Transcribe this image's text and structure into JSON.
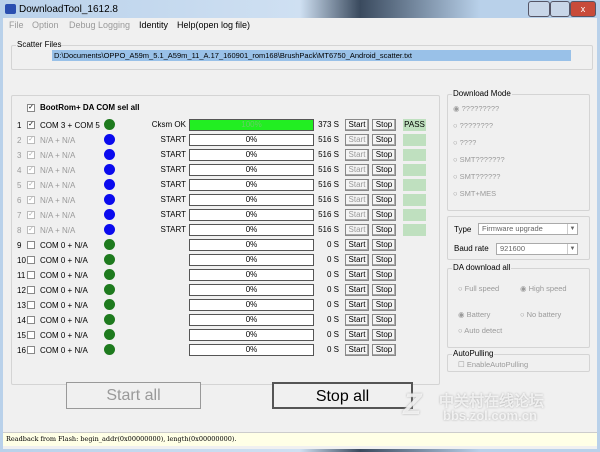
{
  "window": {
    "title": "DownloadTool_1612.8"
  },
  "menu": [
    "File",
    "Option",
    "Debug Logging",
    "Identity",
    "Help(open log file)"
  ],
  "scatter": {
    "label": "Scatter Files",
    "path": "D:\\Documents\\OPPO_A59m_5.1_A59m_11_A.17_160901_rom168\\BrushPack\\MT6750_Android_scatter.txt"
  },
  "sel_all": {
    "label": "BootRom+ DA COM sel all",
    "checked": true
  },
  "colors": {
    "green_dot": "#1e7a1e",
    "blue_dot": "#0a0aee",
    "progress_fill": "#22ee22",
    "pass_bg": "#bfe0bf"
  },
  "rows": [
    {
      "num": "1",
      "port": "COM 3 + COM 5",
      "dot": "green",
      "status": "Cksm OK",
      "progress": "100%",
      "time": "373 S",
      "start": "Start",
      "stop": "Stop",
      "result": "PASS",
      "enabled": true
    },
    {
      "num": "2",
      "port": "N/A + N/A",
      "dot": "blue",
      "status": "START",
      "progress": "0%",
      "time": "516 S",
      "start": "Start",
      "stop": "Stop",
      "result": "",
      "enabled": false
    },
    {
      "num": "3",
      "port": "N/A + N/A",
      "dot": "blue",
      "status": "START",
      "progress": "0%",
      "time": "516 S",
      "start": "Start",
      "stop": "Stop",
      "result": "",
      "enabled": false
    },
    {
      "num": "4",
      "port": "N/A + N/A",
      "dot": "blue",
      "status": "START",
      "progress": "0%",
      "time": "516 S",
      "start": "Start",
      "stop": "Stop",
      "result": "",
      "enabled": false
    },
    {
      "num": "5",
      "port": "N/A + N/A",
      "dot": "blue",
      "status": "START",
      "progress": "0%",
      "time": "516 S",
      "start": "Start",
      "stop": "Stop",
      "result": "",
      "enabled": false
    },
    {
      "num": "6",
      "port": "N/A + N/A",
      "dot": "blue",
      "status": "START",
      "progress": "0%",
      "time": "516 S",
      "start": "Start",
      "stop": "Stop",
      "result": "",
      "enabled": false
    },
    {
      "num": "7",
      "port": "N/A + N/A",
      "dot": "blue",
      "status": "START",
      "progress": "0%",
      "time": "516 S",
      "start": "Start",
      "stop": "Stop",
      "result": "",
      "enabled": false
    },
    {
      "num": "8",
      "port": "N/A + N/A",
      "dot": "blue",
      "status": "START",
      "progress": "0%",
      "time": "516 S",
      "start": "Start",
      "stop": "Stop",
      "result": "",
      "enabled": false
    },
    {
      "num": "9",
      "port": "COM 0 + N/A",
      "dot": "green",
      "status": "",
      "progress": "0%",
      "time": "0 S",
      "start": "Start",
      "stop": "Stop",
      "result": "",
      "enabled": true
    },
    {
      "num": "10",
      "port": "COM 0 + N/A",
      "dot": "green",
      "status": "",
      "progress": "0%",
      "time": "0 S",
      "start": "Start",
      "stop": "Stop",
      "result": "",
      "enabled": true
    },
    {
      "num": "11",
      "port": "COM 0 + N/A",
      "dot": "green",
      "status": "",
      "progress": "0%",
      "time": "0 S",
      "start": "Start",
      "stop": "Stop",
      "result": "",
      "enabled": true
    },
    {
      "num": "12",
      "port": "COM 0 + N/A",
      "dot": "green",
      "status": "",
      "progress": "0%",
      "time": "0 S",
      "start": "Start",
      "stop": "Stop",
      "result": "",
      "enabled": true
    },
    {
      "num": "13",
      "port": "COM 0 + N/A",
      "dot": "green",
      "status": "",
      "progress": "0%",
      "time": "0 S",
      "start": "Start",
      "stop": "Stop",
      "result": "",
      "enabled": true
    },
    {
      "num": "14",
      "port": "COM 0 + N/A",
      "dot": "green",
      "status": "",
      "progress": "0%",
      "time": "0 S",
      "start": "Start",
      "stop": "Stop",
      "result": "",
      "enabled": true
    },
    {
      "num": "15",
      "port": "COM 0 + N/A",
      "dot": "green",
      "status": "",
      "progress": "0%",
      "time": "0 S",
      "start": "Start",
      "stop": "Stop",
      "result": "",
      "enabled": true
    },
    {
      "num": "16",
      "port": "COM 0 + N/A",
      "dot": "green",
      "status": "",
      "progress": "0%",
      "time": "0 S",
      "start": "Start",
      "stop": "Stop",
      "result": "",
      "enabled": true
    }
  ],
  "download_mode": {
    "label": "Download Mode",
    "options": [
      "?????????",
      "????????",
      "????",
      "SMT???????",
      "SMT??????",
      "SMT+MES"
    ],
    "selected": 0
  },
  "type": {
    "label": "Type",
    "value": "Firmware upgrade"
  },
  "baud": {
    "label": "Baud rate",
    "value": "921600"
  },
  "da": {
    "label": "DA download all",
    "speed": [
      "Full speed",
      "High speed"
    ],
    "speed_selected": 1,
    "power": [
      "Battery",
      "No battery",
      "Auto detect"
    ],
    "power_selected": 0
  },
  "autopulling": {
    "label": "AutoPulling",
    "checkbox": "EnableAutoPulling"
  },
  "buttons": {
    "start_all": "Start all",
    "stop_all": "Stop all"
  },
  "status_bar": "Readback from Flash:  begin_addr(0x00000000), length(0x00000000).",
  "watermark": {
    "cn": "中关村在线论坛",
    "url": "bbs.zol.com.cn"
  }
}
